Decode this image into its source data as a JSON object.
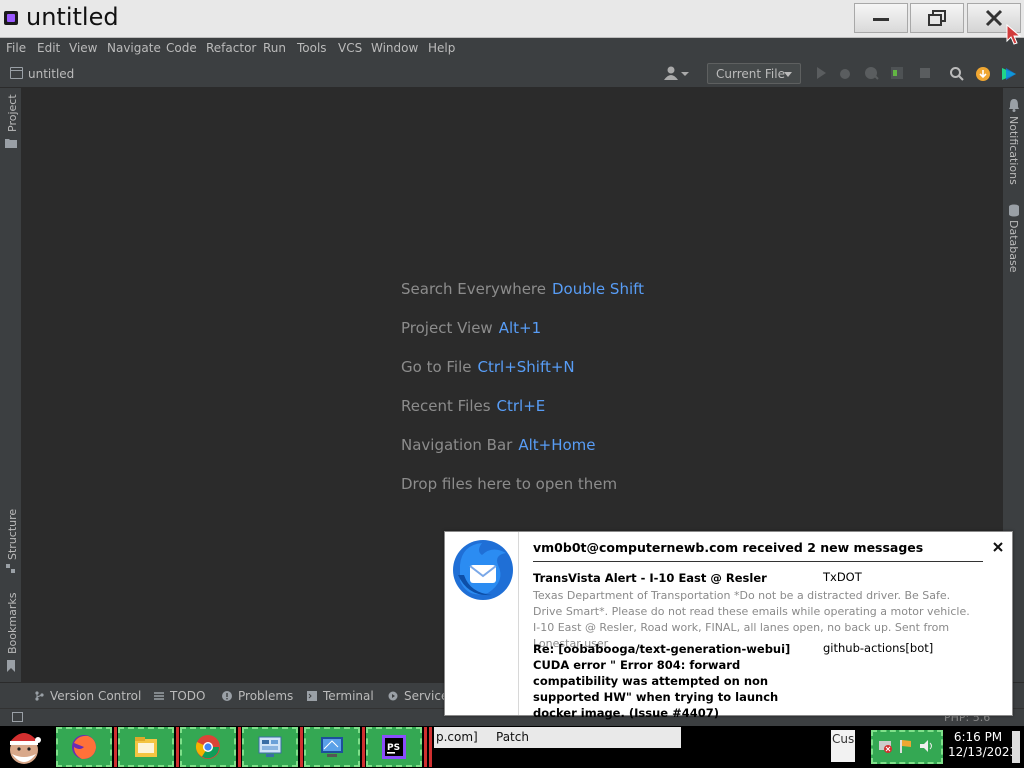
{
  "window": {
    "title": "untitled"
  },
  "menu": [
    "File",
    "Edit",
    "View",
    "Navigate",
    "Code",
    "Refactor",
    "Run",
    "Tools",
    "VCS",
    "Window",
    "Help"
  ],
  "toolbar": {
    "project_name": "untitled",
    "run_config": "Current File"
  },
  "left_stripe": {
    "project": "Project",
    "structure": "Structure",
    "bookmarks": "Bookmarks"
  },
  "right_stripe": {
    "notifications": "Notifications",
    "database": "Database"
  },
  "editor_hints": [
    {
      "label": "Search Everywhere",
      "shortcut": "Double Shift"
    },
    {
      "label": "Project View",
      "shortcut": "Alt+1"
    },
    {
      "label": "Go to File",
      "shortcut": "Ctrl+Shift+N"
    },
    {
      "label": "Recent Files",
      "shortcut": "Ctrl+E"
    },
    {
      "label": "Navigation Bar",
      "shortcut": "Alt+Home"
    },
    {
      "label": "Drop files here to open them",
      "shortcut": ""
    }
  ],
  "bottom_tabs": [
    "Version Control",
    "TODO",
    "Problems",
    "Terminal",
    "Services"
  ],
  "status": {
    "php_version": "PHP: 5.6"
  },
  "notification": {
    "title": "vm0b0t@computernewb.com received 2 new messages",
    "messages": [
      {
        "subject": "TransVista Alert - I-10 East @ Resler",
        "from": "TxDOT",
        "preview": "Texas Department of Transportation *Do not be a distracted driver. Be Safe. Drive Smart*. Please do not read these emails while operating a motor vehicle. I-10 East @ Resler, Road work, FINAL, all lanes open, no back up. Sent from Lonestar user"
      },
      {
        "subject": "Re: [oobabooga/text-generation-webui] CUDA error \" Error 804: forward compatibility was attempted on non supported HW\" when trying to launch docker image. (Issue #4407)",
        "from": "github-actions[bot]",
        "preview": ""
      }
    ]
  },
  "taskbar": {
    "strip_text_a": "p.com]",
    "strip_text_b": "Patch",
    "cus_text": "Cus",
    "time": "6:16 PM",
    "date": "12/13/2023"
  },
  "colors": {
    "ide_bg": "#2b2b2b",
    "ide_panel": "#3c3f41",
    "shortcut_blue": "#589df6",
    "taskbar_green": "#34a853"
  }
}
